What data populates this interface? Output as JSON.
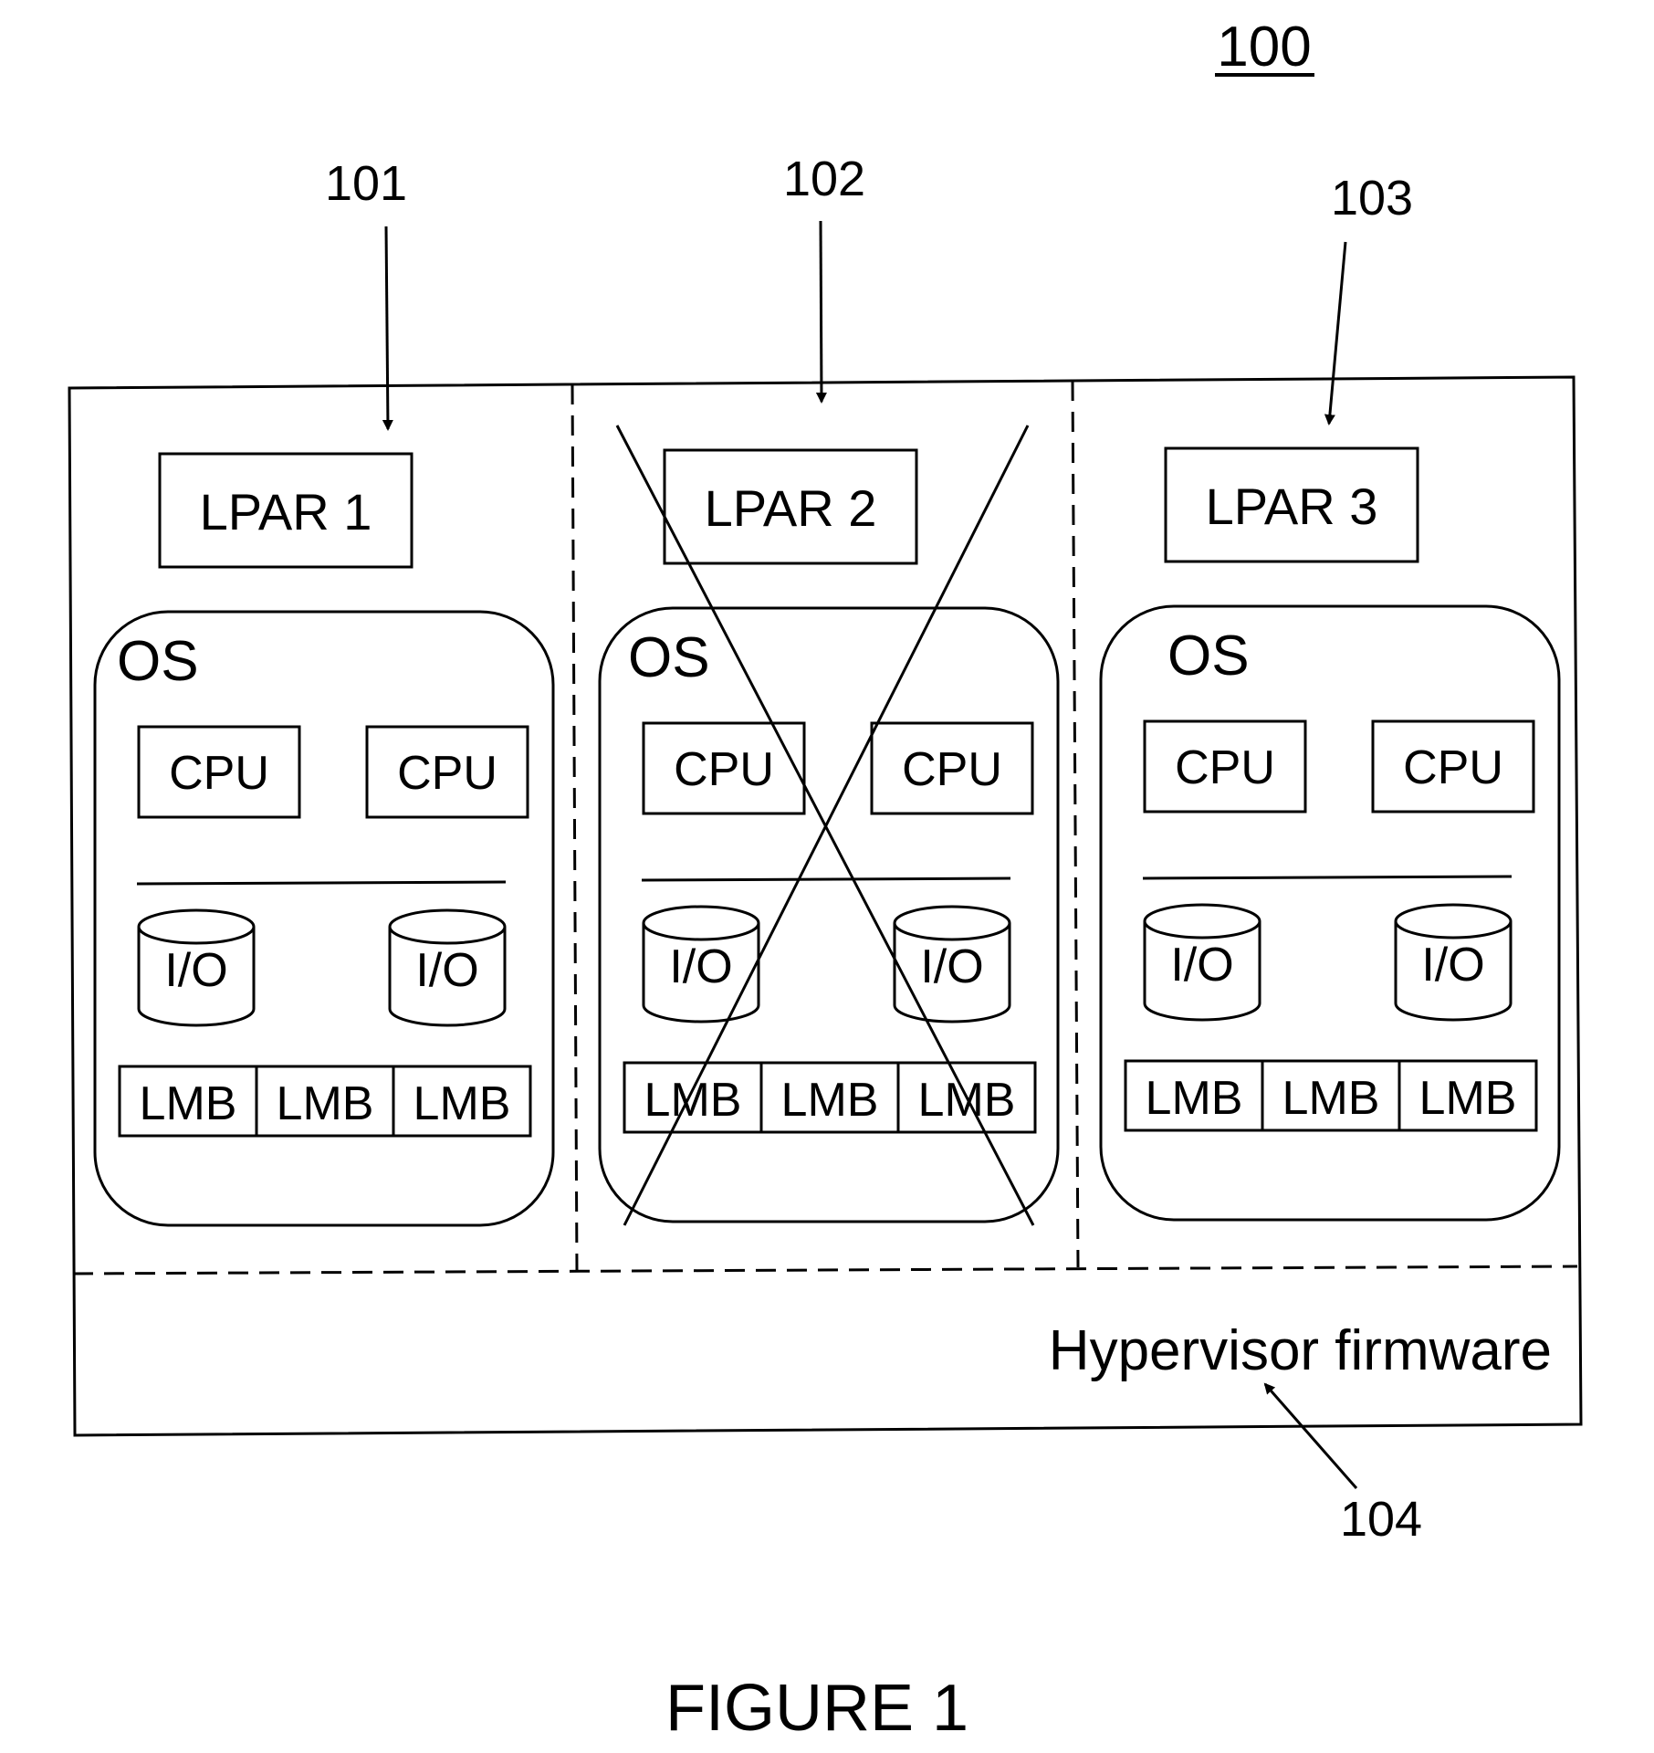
{
  "figure": {
    "number_label": "100",
    "caption": "FIGURE 1"
  },
  "reference_numerals": {
    "lpar1": "101",
    "lpar2": "102",
    "lpar3": "103",
    "hypervisor": "104"
  },
  "partitions": [
    {
      "id": "lpar1",
      "title": "LPAR 1",
      "os_label": "OS",
      "cpus": [
        "CPU",
        "CPU"
      ],
      "io_devices": [
        "I/O",
        "I/O"
      ],
      "memory_blocks": [
        "LMB",
        "LMB",
        "LMB"
      ],
      "crossed_out": false
    },
    {
      "id": "lpar2",
      "title": "LPAR 2",
      "os_label": "OS",
      "cpus": [
        "CPU",
        "CPU"
      ],
      "io_devices": [
        "I/O",
        "I/O"
      ],
      "memory_blocks": [
        "LMB",
        "LMB",
        "LMB"
      ],
      "crossed_out": true
    },
    {
      "id": "lpar3",
      "title": "LPAR 3",
      "os_label": "OS",
      "cpus": [
        "CPU",
        "CPU"
      ],
      "io_devices": [
        "I/O",
        "I/O"
      ],
      "memory_blocks": [
        "LMB",
        "LMB",
        "LMB"
      ],
      "crossed_out": false
    }
  ],
  "hypervisor": {
    "label": "Hypervisor firmware"
  },
  "colors": {
    "ink": "#000000",
    "paper": "#ffffff"
  }
}
